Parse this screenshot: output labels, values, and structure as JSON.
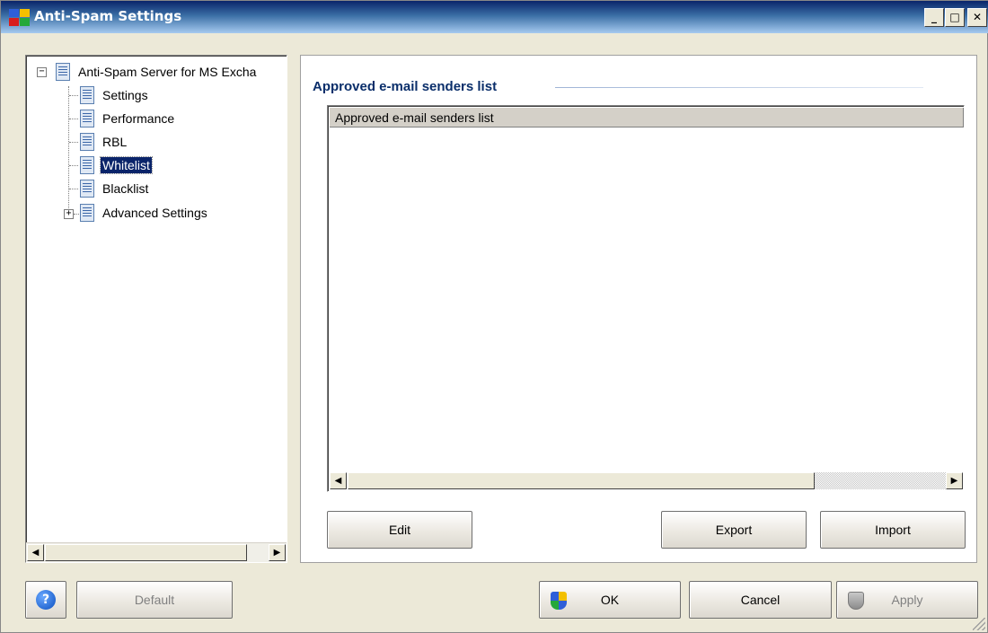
{
  "window": {
    "title": "Anti-Spam Settings",
    "controls": {
      "minimize": "_",
      "maximize": "□",
      "close": "✕"
    }
  },
  "tree": {
    "root": "Anti-Spam Server for MS Excha",
    "items": [
      {
        "label": "Settings"
      },
      {
        "label": "Performance"
      },
      {
        "label": "RBL"
      },
      {
        "label": "Whitelist",
        "selected": true
      },
      {
        "label": "Blacklist"
      },
      {
        "label": "Advanced Settings",
        "expandable": true
      }
    ]
  },
  "content": {
    "section_title": "Approved e-mail senders list",
    "list_header": "Approved e-mail senders list",
    "buttons": {
      "edit": "Edit",
      "export": "Export",
      "import": "Import"
    }
  },
  "footer": {
    "help": "?",
    "default": "Default",
    "ok": "OK",
    "cancel": "Cancel",
    "apply": "Apply"
  },
  "colors": {
    "accent": "#0a246a",
    "section_title": "#0a2e6a",
    "face": "#ece9d8"
  }
}
